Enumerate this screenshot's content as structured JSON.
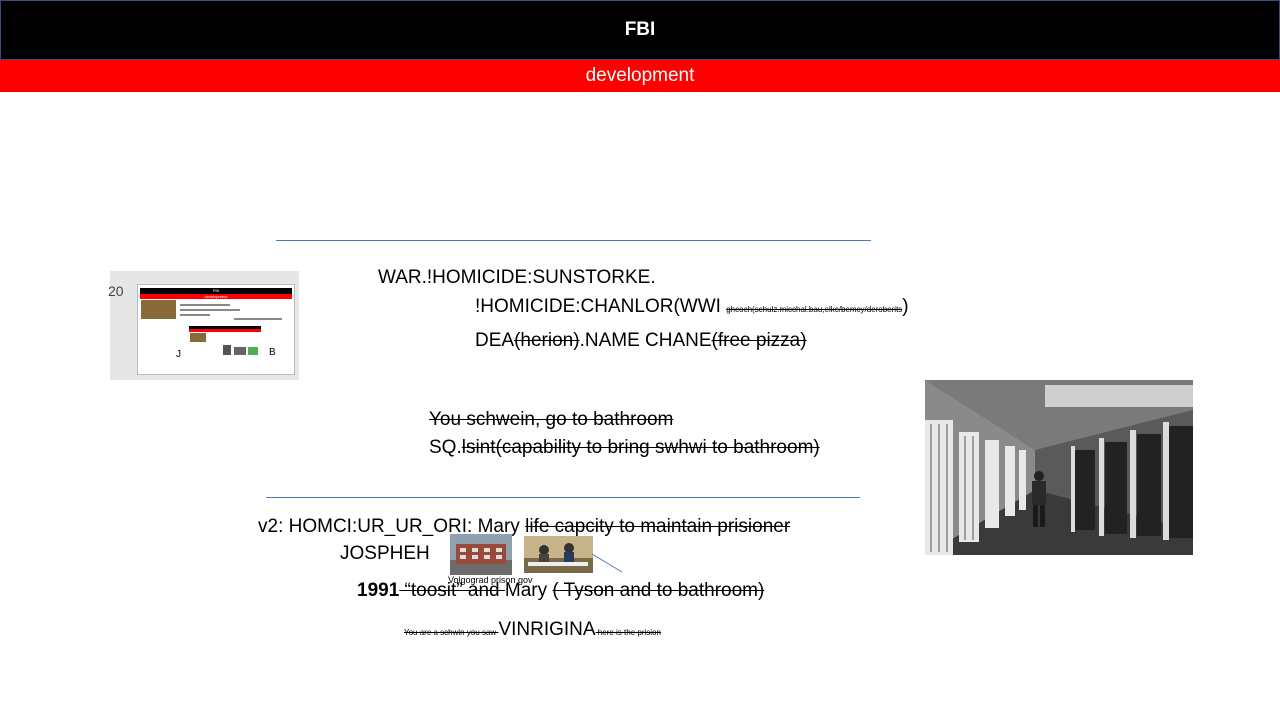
{
  "header": {
    "title": "FBI",
    "subtitle": "development"
  },
  "thumbnail": {
    "slide_number": "20",
    "title": "FBI",
    "subtitle": "development",
    "label_left": "J",
    "label_right": "B"
  },
  "lines": {
    "line1": "WAR.!HOMICIDE:SUNSTORKE.",
    "line2_main": "!HOMICIDE:CHANLOR(WWI ",
    "line2_struck": "ghcoch(schulz.micchal.bau,elkc/bemcy/deroberits",
    "line2_end": ")",
    "line3_a": "DEA",
    "line3_b_struck": "(herion)",
    "line3_c": ".NAME CHANE",
    "line3_d_struck": "(free pizza)",
    "line4_struck": "You schwein, go to bathroom ",
    "line5_a": "SQ.",
    "line5_b_struck": "lsint(capability to bring swhwi to bathroom)",
    "line6_a": "v2: HOMCI:UR_UR_ORI: Mary ",
    "line6_b_struck": "life capcity to maintain prisioner",
    "line7": "JOSPHEH",
    "caption": "Volgograd prison gov",
    "line8_a": "1991",
    "line8_b_struck": " “toosit” and ",
    "line8_c": "Mary ",
    "line8_d_struck": "( Tyson and  to bathroom)",
    "line9_a_struck": "You are a schwin you saw ",
    "line9_b": "VINRIGINA",
    "line9_c_struck": " here is the prision"
  }
}
